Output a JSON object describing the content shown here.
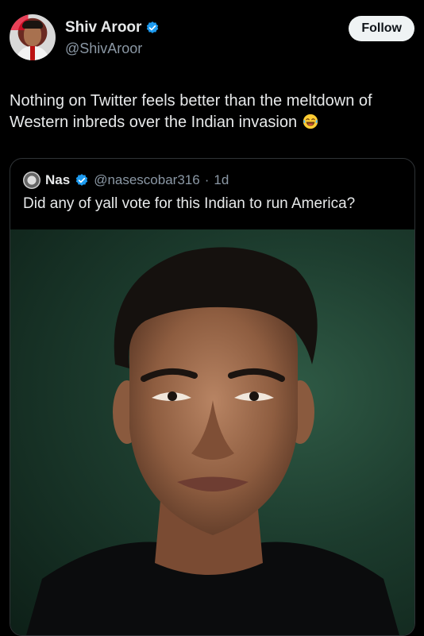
{
  "author": {
    "name": "Shiv Aroor",
    "handle": "@ShivAroor",
    "follow_label": "Follow"
  },
  "tweet": {
    "text": "Nothing on Twitter feels better than the meltdown of Western inbreds over the Indian invasion",
    "emoji": "laughing-tears-emoji"
  },
  "quoted": {
    "name": "Nas",
    "handle": "@nasescobar316",
    "separator": "·",
    "time": "1d",
    "text": "Did any of yall vote for this Indian to run America?",
    "image": "portrait photo of a man on a dark green background"
  },
  "colors": {
    "background": "#000000",
    "text": "#e7e9ea",
    "secondary": "#8b98a5",
    "verified": "#1d9bf0",
    "border": "#2f3336"
  }
}
